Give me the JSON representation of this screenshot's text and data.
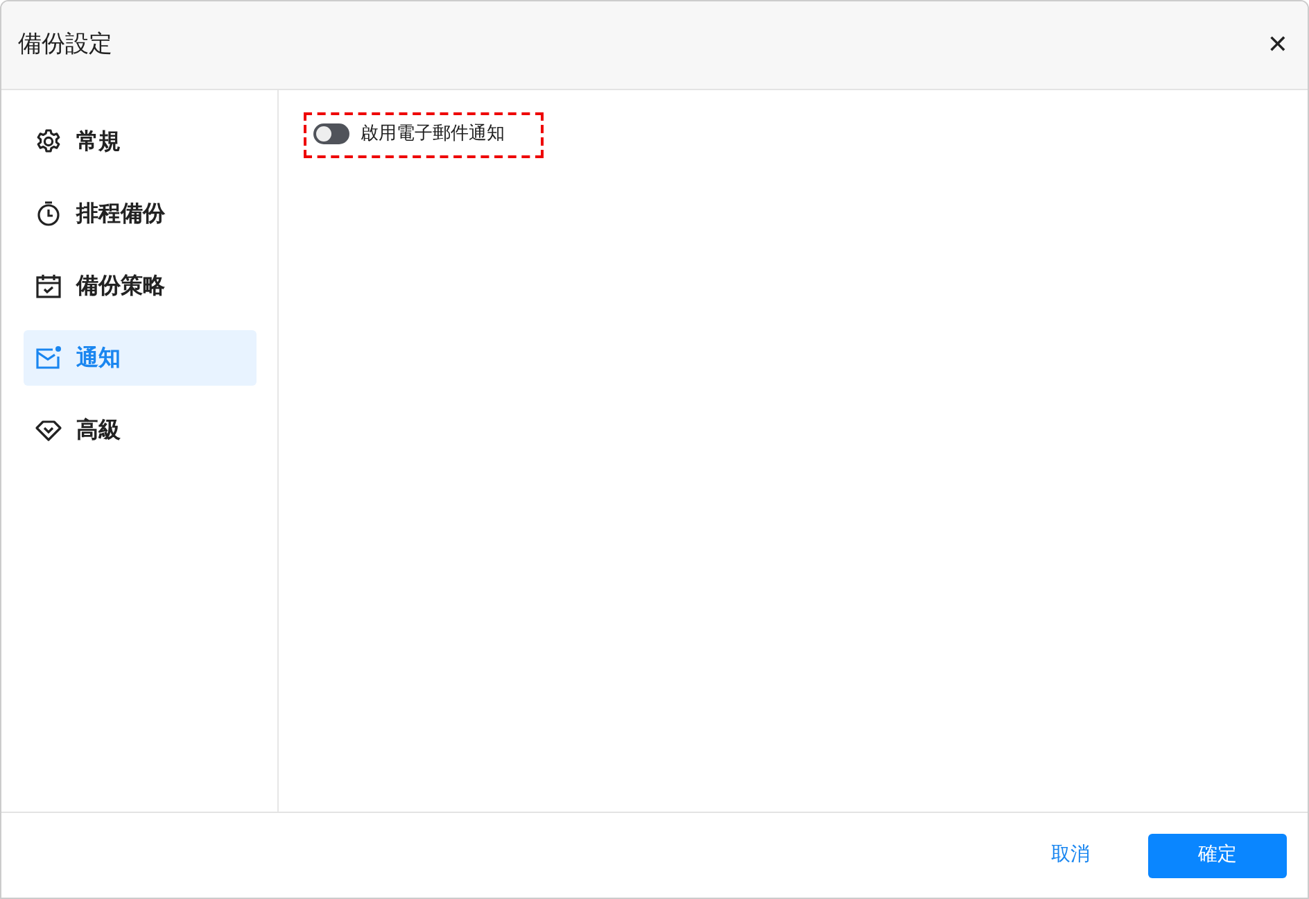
{
  "window": {
    "title": "備份設定",
    "close": "✕"
  },
  "sidebar": {
    "items": [
      {
        "kind": "gear",
        "label": "常規",
        "selected": false
      },
      {
        "kind": "timer",
        "label": "排程備份",
        "selected": false
      },
      {
        "kind": "calendar",
        "label": "備份策略",
        "selected": false
      },
      {
        "kind": "mail",
        "label": "通知",
        "selected": true
      },
      {
        "kind": "diamond",
        "label": "高級",
        "selected": false
      }
    ]
  },
  "content": {
    "email_toggle": {
      "label": "啟用電子郵件通知",
      "on": false,
      "highlighted": true
    }
  },
  "buttons": [
    {
      "kind": "link",
      "label": "取消"
    },
    {
      "kind": "primary",
      "label": "確定"
    }
  ]
}
